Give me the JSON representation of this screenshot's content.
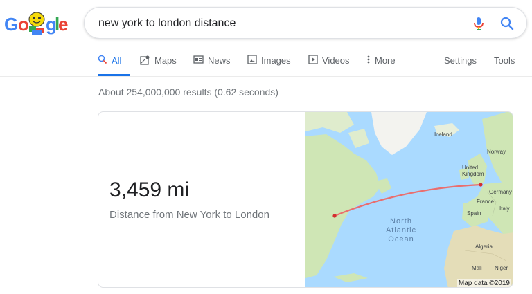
{
  "logo": {
    "letters": [
      "G",
      "o",
      "o",
      "g",
      "l",
      "e"
    ]
  },
  "search": {
    "query": "new york to london distance"
  },
  "tabs": [
    {
      "label": "All",
      "icon": "search-icon",
      "active": true
    },
    {
      "label": "Maps",
      "icon": "maps-icon",
      "active": false
    },
    {
      "label": "News",
      "icon": "news-icon",
      "active": false
    },
    {
      "label": "Images",
      "icon": "images-icon",
      "active": false
    },
    {
      "label": "Videos",
      "icon": "videos-icon",
      "active": false
    },
    {
      "label": "More",
      "icon": "more-vert-icon",
      "active": false
    }
  ],
  "tools": {
    "settings": "Settings",
    "tools": "Tools"
  },
  "stats": "About 254,000,000 results (0.62 seconds)",
  "answer": {
    "distance": "3,459 mi",
    "label": "Distance from New York to London"
  },
  "map": {
    "labels": {
      "iceland": "Iceland",
      "norway": "Norway",
      "uk": "United Kingdom",
      "germany": "Germany",
      "france": "France",
      "italy": "Italy",
      "spain": "Spain",
      "algeria": "Algeria",
      "mali": "Mali",
      "niger": "Niger"
    },
    "ocean": [
      "North",
      "Atlantic",
      "Ocean"
    ],
    "attribution": "Map data ©2019"
  },
  "colors": {
    "accent": "#1a73e8",
    "route": "#ea6e6e",
    "water": "#aadaff",
    "land": "#cfe6b5"
  }
}
